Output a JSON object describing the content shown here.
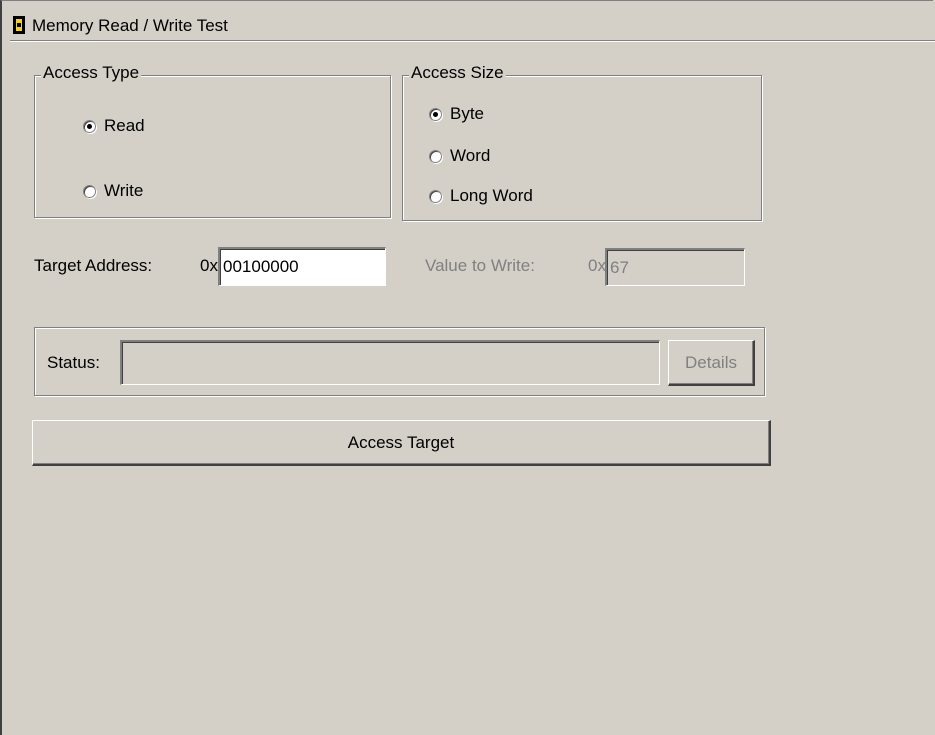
{
  "window": {
    "title": "Memory Read / Write Test"
  },
  "access_type": {
    "label": "Access Type",
    "options": [
      {
        "label": "Read",
        "selected": true
      },
      {
        "label": "Write",
        "selected": false
      }
    ]
  },
  "access_size": {
    "label": "Access Size",
    "options": [
      {
        "label": "Byte",
        "selected": true
      },
      {
        "label": "Word",
        "selected": false
      },
      {
        "label": "Long Word",
        "selected": false
      }
    ]
  },
  "target_address": {
    "label": "Target Address:",
    "prefix": "0x",
    "value": "00100000"
  },
  "value_to_write": {
    "label": "Value to Write:",
    "prefix": "0x",
    "value": "67",
    "enabled": false
  },
  "status": {
    "label": "Status:",
    "value": "",
    "details_label": "Details"
  },
  "access_target_button": {
    "label": "Access Target"
  },
  "colors": {
    "background": "#d4d0c8",
    "disabled_text": "#808080",
    "icon_accent": "#f2d21a"
  }
}
